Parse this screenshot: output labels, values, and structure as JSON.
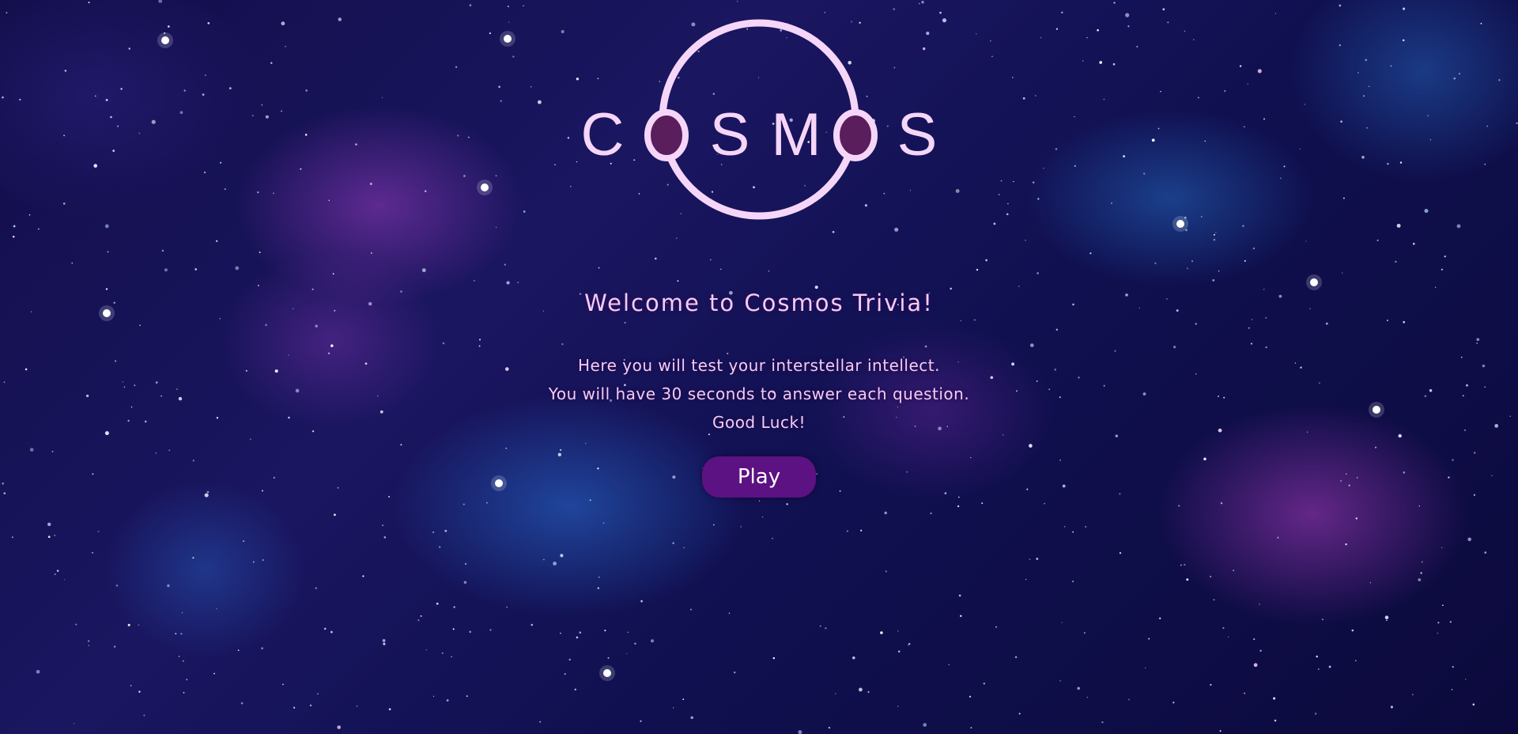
{
  "logo": {
    "letters": [
      "C",
      "O",
      "S",
      "M",
      "O",
      "S"
    ],
    "ring_color": "#f6d6f8",
    "o_fill_color": "#5a1e5c"
  },
  "welcome": {
    "title": "Welcome to Cosmos Trivia!"
  },
  "description": {
    "line1": "Here you will test your interstellar intellect.",
    "line2": "You will have 30 seconds to answer each question.",
    "line3": "Good Luck!"
  },
  "play_button": {
    "label": "Play"
  },
  "colors": {
    "text": "#f2cdf3",
    "button_bg": "#5c1282",
    "background": "#120e4a"
  }
}
